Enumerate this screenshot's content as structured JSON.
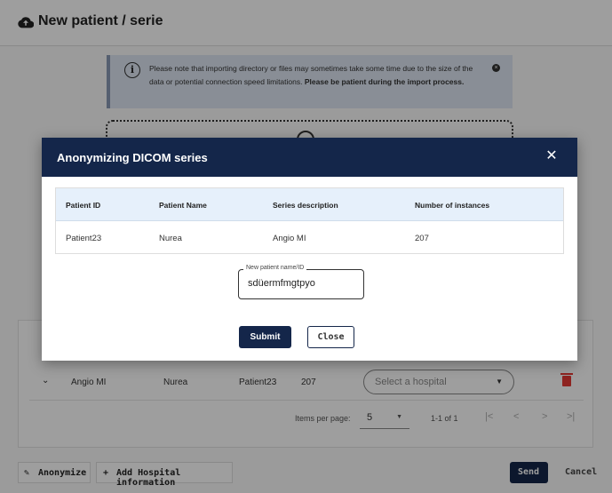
{
  "header": {
    "title": "New patient / serie",
    "icon": "cloud-upload-icon"
  },
  "notice": {
    "text": "Please note that importing directory or files may sometimes take some time due to the size of the data or potential connection speed limitations.",
    "bold_text": "Please be patient during the import process."
  },
  "series_table": {
    "row": {
      "description": "Angio MI",
      "patient_name": "Nurea",
      "patient_id": "Patient23",
      "instances": "207"
    },
    "hospital_select": {
      "placeholder": "Select a hospital"
    },
    "paginator": {
      "items_per_page_label": "Items per page:",
      "items_per_page": "5",
      "range": "1-1 of 1"
    }
  },
  "bottom_bar": {
    "anonymize_label": "Anonymize",
    "add_hospital_label": "Add Hospital information",
    "send_label": "Send",
    "cancel_label": "Cancel"
  },
  "dialog": {
    "title": "Anonymizing DICOM series",
    "columns": [
      "Patient ID",
      "Patient Name",
      "Series description",
      "Number of instances"
    ],
    "row": [
      "Patient23",
      "Nurea",
      "Angio MI",
      "207"
    ],
    "new_name_field": {
      "label": "New patient name/ID",
      "value": "sdüermfmgtpyo"
    },
    "submit_label": "Submit",
    "close_label": "Close"
  },
  "colors": {
    "primary": "#14264a",
    "danger": "#e53935",
    "table_header": "#e6f0fb",
    "notice_bg": "#dde6f2"
  }
}
